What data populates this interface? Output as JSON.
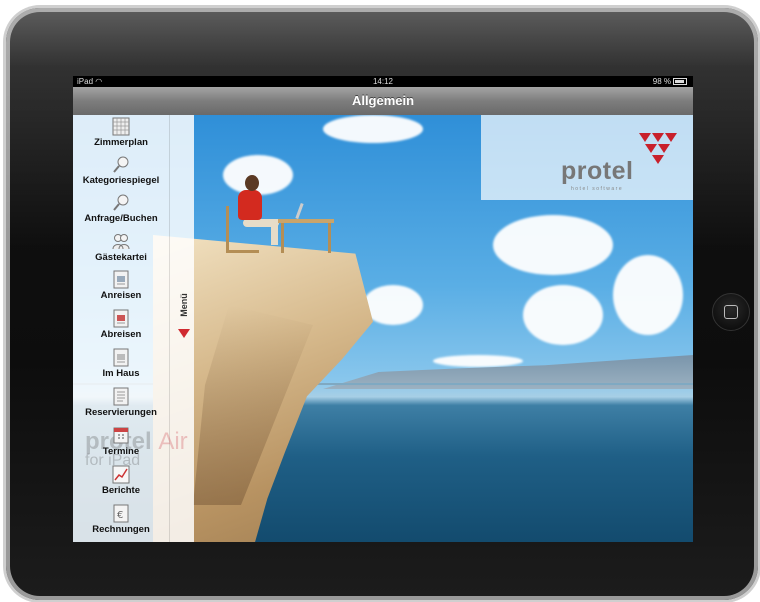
{
  "status_bar": {
    "device": "iPad",
    "time": "14:12",
    "battery": "98 %"
  },
  "navbar": {
    "title": "Allgemein"
  },
  "sidebar": {
    "items": [
      {
        "label": "Zimmerplan",
        "icon": "grid-plan-icon"
      },
      {
        "label": "Kategoriespiegel",
        "icon": "magnifier-icon"
      },
      {
        "label": "Anfrage/Buchen",
        "icon": "search-booking-icon"
      },
      {
        "label": "Gästekartei",
        "icon": "guests-icon"
      },
      {
        "label": "Anreisen",
        "icon": "arrival-icon"
      },
      {
        "label": "Abreisen",
        "icon": "departure-icon"
      },
      {
        "label": "Im Haus",
        "icon": "in-house-icon"
      },
      {
        "label": "Reservierungen",
        "icon": "reservations-icon"
      },
      {
        "label": "Termine",
        "icon": "calendar-icon"
      },
      {
        "label": "Berichte",
        "icon": "chart-icon"
      },
      {
        "label": "Rechnungen",
        "icon": "invoice-icon"
      }
    ],
    "menu_tab": {
      "label": "Menü"
    }
  },
  "watermark": {
    "brand": "protel",
    "product": "Air",
    "suffix": "for iPad"
  },
  "logo": {
    "name": "protel",
    "tagline": "hotel software",
    "accent": "#c8202b"
  }
}
